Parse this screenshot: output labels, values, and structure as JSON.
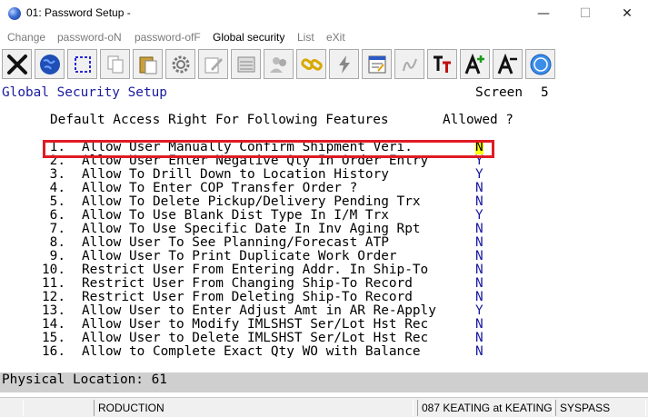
{
  "window": {
    "title": "01: Password Setup -",
    "minimize_glyph": "—",
    "maximize_glyph": "☐",
    "close_glyph": "✕"
  },
  "menu": {
    "items": [
      {
        "label": "Change"
      },
      {
        "label": "password-oN"
      },
      {
        "label": "password-ofF"
      },
      {
        "label": "Global security"
      },
      {
        "label": "List"
      },
      {
        "label": "eXit"
      }
    ]
  },
  "toolbar": {
    "icons": [
      "exit-icon",
      "globe-icon",
      "select-icon",
      "copy-icon",
      "paste-icon",
      "settings-icon",
      "edit-icon",
      "list-icon",
      "users-icon",
      "link-icon",
      "lightning-icon",
      "form-icon",
      "script-icon",
      "font-icon",
      "font-increase-icon",
      "font-decrease-icon",
      "help-icon"
    ]
  },
  "screen": {
    "title": "Global Security Setup",
    "screen_label": "Screen",
    "screen_number": "5",
    "column_header": "Default Access Right For Following Features",
    "allowed_header": "Allowed ?"
  },
  "features": [
    {
      "num": "1.",
      "label": "Allow User Manually Confirm Shipment Veri.",
      "value": "N"
    },
    {
      "num": "2.",
      "label": "Allow User Enter Negative Qty In Order Entry",
      "value": "Y"
    },
    {
      "num": "3.",
      "label": "Allow To Drill Down to Location History",
      "value": "Y"
    },
    {
      "num": "4.",
      "label": "Allow To Enter COP Transfer Order ?",
      "value": "N"
    },
    {
      "num": "5.",
      "label": "Allow To Delete Pickup/Delivery Pending Trx",
      "value": "N"
    },
    {
      "num": "6.",
      "label": "Allow To Use Blank Dist Type In I/M Trx",
      "value": "Y"
    },
    {
      "num": "7.",
      "label": "Allow To Use Specific Date In Inv Aging Rpt",
      "value": "N"
    },
    {
      "num": "8.",
      "label": "Allow User To See Planning/Forecast ATP",
      "value": "N"
    },
    {
      "num": "9.",
      "label": "Allow User To Print Duplicate Work Order",
      "value": "N"
    },
    {
      "num": "10.",
      "label": "Restrict User From Entering Addr. In Ship-To",
      "value": "N"
    },
    {
      "num": "11.",
      "label": "Restrict User From Changing Ship-To Record",
      "value": "N"
    },
    {
      "num": "12.",
      "label": "Restrict User From Deleting Ship-To Record",
      "value": "N"
    },
    {
      "num": "13.",
      "label": "Allow User to Enter Adjust Amt in AR Re-Apply",
      "value": "Y"
    },
    {
      "num": "14.",
      "label": "Allow User to Modify IMLSHST Ser/Lot Hst Rec",
      "value": "N"
    },
    {
      "num": "15.",
      "label": "Allow User to Delete IMLSHST Ser/Lot Hst Rec",
      "value": "N"
    },
    {
      "num": "16.",
      "label": "Allow to Complete Exact Qty WO with Balance",
      "value": "N"
    }
  ],
  "physical_location": "Physical Location: 61",
  "status": {
    "cell1": "",
    "cell2": "RODUCTION",
    "cell3": "087 KEATING at KEATING",
    "cell4": "SYSPASS"
  },
  "colors": {
    "highlight_border": "#e01b24",
    "cursor_background": "#ffff00",
    "value_text": "#1a1aa0"
  }
}
